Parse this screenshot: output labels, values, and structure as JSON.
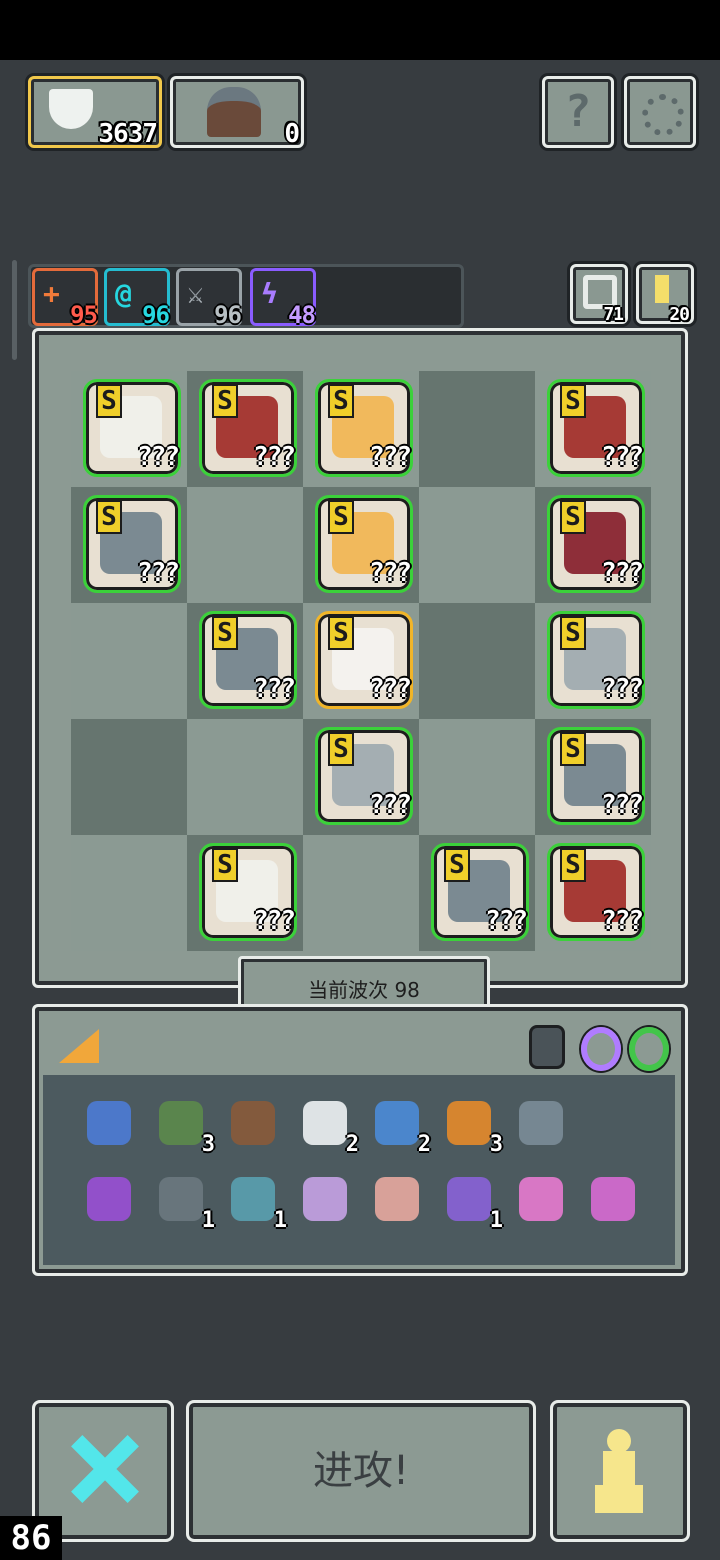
{
  "resources": [
    {
      "icon": "gem-heart-icon",
      "value": "3637"
    },
    {
      "icon": "helmet-icon",
      "value": "0"
    }
  ],
  "top_buttons": [
    {
      "icon": "help-icon",
      "label": "?"
    },
    {
      "icon": "settings-gear-icon",
      "label": ""
    }
  ],
  "stats": [
    {
      "icon": "health-cross-icon",
      "symbol": "+",
      "value": "95",
      "color": "#ff5b4c"
    },
    {
      "icon": "mana-swirl-icon",
      "symbol": "@",
      "value": "96",
      "color": "#26d7e0"
    },
    {
      "icon": "sword-icon",
      "symbol": "⚔",
      "value": "96",
      "color": "#aab2b8"
    },
    {
      "icon": "lightning-icon",
      "symbol": "ϟ",
      "value": "48",
      "color": "#a97cff"
    }
  ],
  "counters": [
    {
      "icon": "refresh-icon",
      "value": "71"
    },
    {
      "icon": "key-icon",
      "value": "20"
    }
  ],
  "board": {
    "rows": [
      [
        {
          "unit": "king-mage",
          "rank": "S",
          "label": "???"
        },
        {
          "unit": "warrior-red",
          "rank": "S",
          "label": "???"
        },
        {
          "unit": "golem-orange",
          "rank": "S",
          "label": "???"
        },
        null,
        {
          "unit": "warrior-red",
          "rank": "S",
          "label": "???"
        }
      ],
      [
        {
          "unit": "knight-helm",
          "rank": "S",
          "label": "???"
        },
        null,
        {
          "unit": "golem-orange",
          "rank": "S",
          "label": "???"
        },
        null,
        {
          "unit": "hood-red",
          "rank": "S",
          "label": "???"
        }
      ],
      [
        null,
        {
          "unit": "knight-helm",
          "rank": "S",
          "label": "???"
        },
        {
          "unit": "priestess-white",
          "rank": "S",
          "label": "???",
          "gold": true
        },
        null,
        {
          "unit": "girl-gray",
          "rank": "S",
          "label": "???"
        }
      ],
      [
        null,
        null,
        {
          "unit": "girl-gray",
          "rank": "S",
          "label": "???"
        },
        null,
        {
          "unit": "knight-helm",
          "rank": "S",
          "label": "???"
        }
      ],
      [
        null,
        {
          "unit": "king-mage",
          "rank": "S",
          "label": "???"
        },
        null,
        {
          "unit": "knight-helm",
          "rank": "S",
          "label": "???"
        },
        {
          "unit": "warrior-red",
          "rank": "S",
          "label": "???"
        }
      ]
    ]
  },
  "wave": {
    "label": "当前波次 98"
  },
  "inventory": {
    "tab_icon": "cheese-wedge-icon",
    "ring_icons": [
      "armor-icon",
      "ring-purple-icon",
      "ring-green-icon"
    ],
    "row1": [
      {
        "icon": "goggles-icon",
        "count": ""
      },
      {
        "icon": "green-hood-icon",
        "count": "3"
      },
      {
        "icon": "rune-frame-icon",
        "count": ""
      },
      {
        "icon": "wings-icon",
        "count": "2"
      },
      {
        "icon": "blue-crossbow-icon",
        "count": "2"
      },
      {
        "icon": "orange-orb-icon",
        "count": "3"
      },
      {
        "icon": "hammer-stand-icon",
        "count": ""
      }
    ],
    "row2": [
      {
        "icon": "purple-scepter-icon",
        "count": ""
      },
      {
        "icon": "helmet-icon",
        "count": "1"
      },
      {
        "icon": "ship-icon",
        "count": "1"
      },
      {
        "icon": "dagger-icon",
        "count": ""
      },
      {
        "icon": "fist-icon",
        "count": ""
      },
      {
        "icon": "potion-jar-icon",
        "count": "1"
      },
      {
        "icon": "arrow-icon",
        "count": ""
      },
      {
        "icon": "pink-blade-icon",
        "count": ""
      }
    ]
  },
  "actions": {
    "cancel_icon": "cross-x-icon",
    "attack_label": "进攻!",
    "pawn_icon": "pawn-icon",
    "counter": "86"
  }
}
